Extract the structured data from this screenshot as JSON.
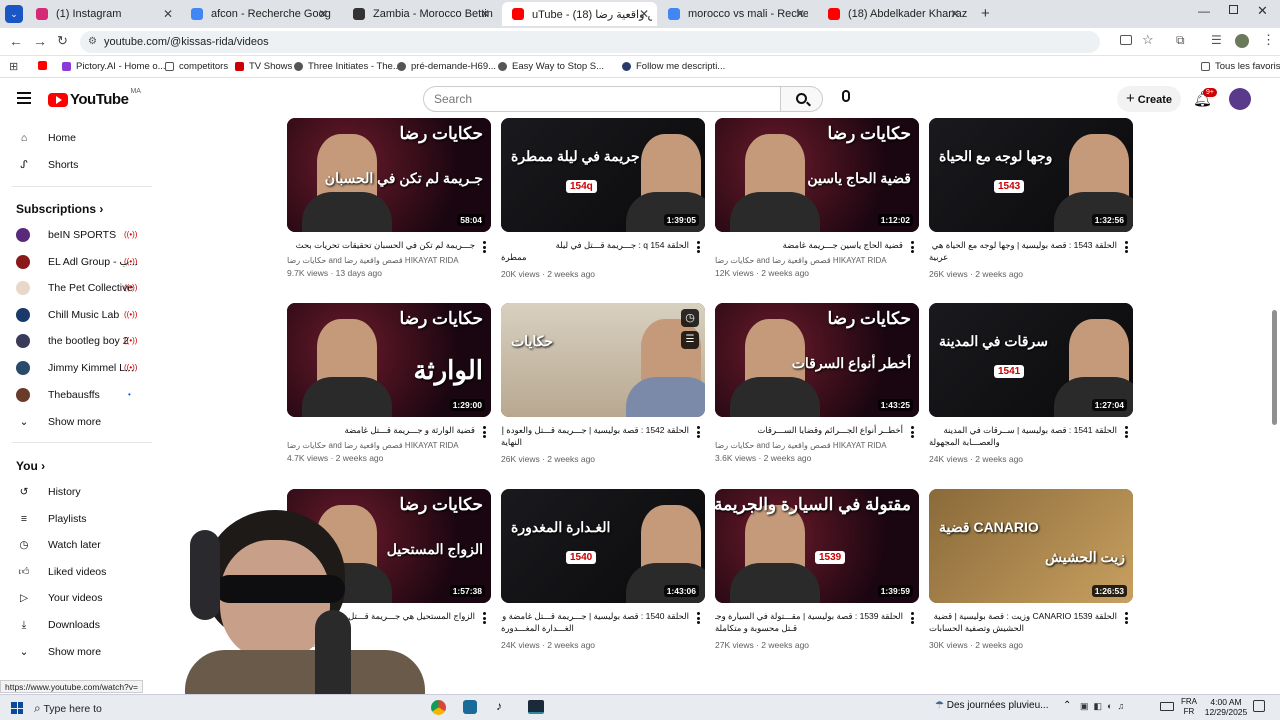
{
  "browser": {
    "tabs": [
      {
        "title": "(1) Instagram",
        "color": "#d62976",
        "active": false
      },
      {
        "title": "afcon - Recherche Google",
        "color": "#4285f4",
        "active": false
      },
      {
        "title": "Zambia - Morocco Betting - 29",
        "color": "#333333",
        "active": false
      },
      {
        "title": "uTube - قصص واقعية رضا (18)",
        "color": "#ff0000",
        "active": true
      },
      {
        "title": "morocco vs mali - Recherche G",
        "color": "#4285f4",
        "active": false
      },
      {
        "title": "(18) Abdelkader Kharraz - YouT",
        "color": "#ff0000",
        "active": false
      }
    ],
    "url": "youtube.com/@kissas-rida/videos",
    "bookmarks": [
      "Pictory.AI - Home o...",
      "competitors",
      "TV Shows",
      "Three Initiates - The...",
      "pré-demande-H69...",
      "Easy Way to Stop S...",
      "Follow me descripti..."
    ],
    "all_bookmarks": "Tous les favoris",
    "status_url": "https://www.youtube.com/watch?v="
  },
  "youtube": {
    "logo": "YouTube",
    "region": "MA",
    "search_placeholder": "Search",
    "create": "Create",
    "notif_badge": "9+"
  },
  "sidebar": {
    "home": "Home",
    "shorts": "Shorts",
    "subscriptions_title": "Subscriptions",
    "subscriptions": [
      {
        "name": "beIN SPORTS",
        "color": "#5a2a7a"
      },
      {
        "name": "EL Adl Group - ب...",
        "color": "#8a1a1a"
      },
      {
        "name": "The Pet Collective",
        "color": "#e8d8c8"
      },
      {
        "name": "Chill Music Lab",
        "color": "#1a3a6a"
      },
      {
        "name": "the bootleg boy 2",
        "color": "#3a3a5a"
      },
      {
        "name": "Jimmy Kimmel L...",
        "color": "#2a4a6a"
      },
      {
        "name": "Thebausffs",
        "color": "#6a3a2a"
      }
    ],
    "show_more_1": "Show more",
    "you_title": "You",
    "you_items": [
      "History",
      "Playlists",
      "Watch later",
      "Liked videos",
      "Your videos",
      "Downloads"
    ],
    "show_more_2": "Show more"
  },
  "videos": [
    {
      "thumb_title": "حكايات رضا",
      "thumb_sub": "جـريمة لم تكن في الحسبان",
      "duration": "58:04",
      "title": "جـــريمة لم تكن في الحسبان تحقيقات تحريات بحث",
      "title2": "",
      "channel": "حكايات رضا and قصص واقعية رضا HIKAYAT RIDA",
      "meta": "9.7K views · 13 days ago",
      "ep": ""
    },
    {
      "thumb_title": "جريمة في ليلة ممطرة",
      "thumb_sub": "",
      "duration": "1:39:05",
      "title": "الحلقة 154 q : جـــريمة قـــتل في ليلة",
      "title2": "ممطرة",
      "channel": "",
      "meta": "20K views · 2 weeks ago",
      "ep": "154q"
    },
    {
      "thumb_title": "حكايات رضا",
      "thumb_sub": "قضية الحاج ياسين",
      "duration": "1:12:02",
      "title": "قضية الحاج ياسين جـــريمة غامضة",
      "title2": "",
      "channel": "حكايات رضا and قصص واقعية رضا HIKAYAT RIDA",
      "meta": "12K views · 2 weeks ago",
      "ep": ""
    },
    {
      "thumb_title": "وجها لوجه مع الحياة",
      "thumb_sub": "",
      "duration": "1:32:56",
      "title": "الحلقة 1543 : قصة بوليسية | وجها لوجه مع الحياة هي قصة",
      "title2": "عربية",
      "channel": "",
      "meta": "26K views · 2 weeks ago",
      "ep": "1543"
    },
    {
      "thumb_title": "حكايات رضا",
      "thumb_sub": "الوارثة",
      "duration": "1:29:00",
      "title": "قضية الوارثة و جـــريمة قـــتل غامضة",
      "title2": "",
      "channel": "حكايات رضا and قصص واقعية رضا HIKAYAT RIDA",
      "meta": "4.7K views · 2 weeks ago",
      "ep": ""
    },
    {
      "thumb_title": "حكايات",
      "thumb_sub": "",
      "duration": "",
      "title": "الحلقة 1542 : قصة بوليسية | جـــريمة قـــتل والعودة إلى",
      "title2": "النهاية",
      "channel": "",
      "meta": "26K views · 2 weeks ago",
      "ep": ""
    },
    {
      "thumb_title": "حكايات رضا",
      "thumb_sub": "أخطر أنواع السرقات",
      "duration": "1:43:25",
      "title": "أخطــر أنواع الجـــرائم وقضايا الســـرقات",
      "title2": "",
      "channel": "حكايات رضا and قصص واقعية رضا HIKAYAT RIDA",
      "meta": "3.6K views · 2 weeks ago",
      "ep": ""
    },
    {
      "thumb_title": "سرقات في المدينة",
      "thumb_sub": "",
      "duration": "1:27:04",
      "title": "الحلقة 1541 : قصة بوليسية | ســرقات في المدينة",
      "title2": "والعصـــابة المجهولة",
      "channel": "",
      "meta": "24K views · 2 weeks ago",
      "ep": "1541"
    },
    {
      "thumb_title": "حكايات رضا",
      "thumb_sub": "الزواج المستحيل",
      "duration": "1:57:38",
      "title": "الزواج المستحيل هي جـــريمة قـــتل محـــ",
      "title2": "",
      "channel": "HIKAYAT RIDA",
      "meta": "2 weeks ago",
      "ep": ""
    },
    {
      "thumb_title": "الغـدارة المغدورة",
      "thumb_sub": "",
      "duration": "1:43:06",
      "title": "الحلقة 1540 : قصة بوليسية | جـــريمة قـــتل غامضة و",
      "title2": "الغـــدارة المغـــدورة",
      "channel": "",
      "meta": "24K views · 2 weeks ago",
      "ep": "1540"
    },
    {
      "thumb_title": "مقتولة في السيارة والجريمة",
      "thumb_sub": "",
      "duration": "1:39:59",
      "title": "الحلقة 1539 : قصة بوليسية | مقـــتولة في السيارة وجـــريمة",
      "title2": "قـتل محسوبة و متكاملة",
      "channel": "",
      "meta": "27K views · 2 weeks ago",
      "ep": "1539"
    },
    {
      "thumb_title": "CANARIO قضية",
      "thumb_sub": "زيت الحشيش",
      "duration": "1:26:53",
      "title": "الحلقة 1539 CANARIO وزيت : قصة بوليسية | قضية",
      "title2": "الحشيش وتصفية الحسابات",
      "channel": "",
      "meta": "30K views · 2 weeks ago",
      "ep": ""
    }
  ],
  "taskbar": {
    "search": "Type here to",
    "weather": "Des journées pluvieu...",
    "lang1": "FRA",
    "lang2": "FR",
    "time": "4:00 AM",
    "date": "12/29/2025"
  }
}
